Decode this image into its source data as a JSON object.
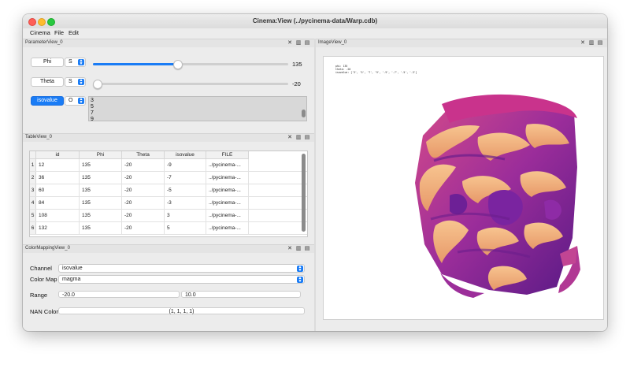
{
  "window": {
    "title": "Cinema:View (../pycinema-data/Warp.cdb)"
  },
  "menu": [
    "Cinema",
    "File",
    "Edit"
  ],
  "parameter_view": {
    "title": "ParameterView_0",
    "params": [
      {
        "name": "Phi",
        "mode": "S",
        "value": "135",
        "slider_fraction": 0.43
      },
      {
        "name": "Theta",
        "mode": "S",
        "value": "-20",
        "slider_fraction": 0.0
      },
      {
        "name": "isovalue",
        "mode": "O",
        "options": [
          "3",
          "5",
          "7",
          "9"
        ]
      }
    ]
  },
  "table_view": {
    "title": "TableView_0",
    "columns": [
      "id",
      "Phi",
      "Theta",
      "isovalue",
      "FILE"
    ],
    "rows": [
      {
        "n": "1",
        "id": "12",
        "phi": "135",
        "theta": "-20",
        "iso": "-9",
        "file": "../pycinema-..."
      },
      {
        "n": "2",
        "id": "36",
        "phi": "135",
        "theta": "-20",
        "iso": "-7",
        "file": "../pycinema-..."
      },
      {
        "n": "3",
        "id": "60",
        "phi": "135",
        "theta": "-20",
        "iso": "-5",
        "file": "../pycinema-..."
      },
      {
        "n": "4",
        "id": "84",
        "phi": "135",
        "theta": "-20",
        "iso": "-3",
        "file": "../pycinema-..."
      },
      {
        "n": "5",
        "id": "108",
        "phi": "135",
        "theta": "-20",
        "iso": "3",
        "file": "../pycinema-..."
      },
      {
        "n": "6",
        "id": "132",
        "phi": "135",
        "theta": "-20",
        "iso": "5",
        "file": "../pycinema-..."
      }
    ]
  },
  "color_mapping_view": {
    "title": "ColorMappingView_0",
    "channel_label": "Channel",
    "channel_value": "isovalue",
    "colormap_label": "Color Map",
    "colormap_value": "magma",
    "range_label": "Range",
    "range_min": "-20.0",
    "range_max": "10.0",
    "nan_label": "NAN Color",
    "nan_value": "(1, 1, 1, 1)"
  },
  "image_view": {
    "title": "ImageView_0",
    "overlay_lines": [
      "phi: 135",
      "theta: -20",
      "isovalue: ['3', '5', '7', '9', '-9', '-7', '-5', '-3']"
    ]
  },
  "colors": {
    "accent": "#1a7cf5",
    "magma_dark": "#5a1a86",
    "magma_mid": "#b83a8f",
    "magma_light": "#f3b27a"
  }
}
